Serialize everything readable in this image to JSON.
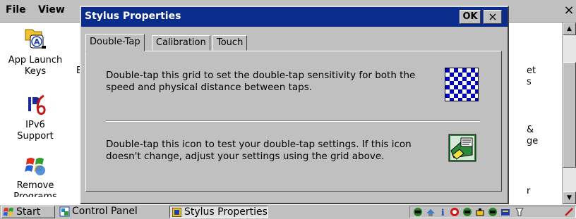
{
  "background_window": {
    "menu": [
      "File",
      "View"
    ],
    "close_glyph": "×",
    "items": [
      {
        "label_line1": "App Launch",
        "label_line2": "Keys",
        "icon": "app-launch-keys-icon"
      },
      {
        "label_line1": "IPv6",
        "label_line2": "Support",
        "icon": "ipv6-icon"
      },
      {
        "label_line1": "Remove",
        "label_line2": "Programs",
        "icon": "remove-programs-icon"
      }
    ],
    "right_fragments": [
      "et",
      "s",
      "&",
      "ge",
      "r"
    ],
    "left_fragment": "E"
  },
  "dialog": {
    "title": "Stylus Properties",
    "ok_label": "OK",
    "close_glyph": "×",
    "tabs": [
      "Double-Tap",
      "Calibration",
      "Touch"
    ],
    "active_tab": "Double-Tap",
    "grid_text": "Double-tap this grid to set the double-tap sensitivity for both the speed and physical distance between taps.",
    "icon_text": "Double-tap this icon to test your double-tap settings. If this icon doesn't change, adjust your settings using the grid above.",
    "grid_colors": {
      "dark": "#0000cc",
      "light": "#ffffff"
    }
  },
  "taskbar": {
    "start_label": "Start",
    "tasks": [
      "Control Panel",
      "Stylus Properties"
    ],
    "active_task": "Stylus Properties",
    "tray_icons": [
      "network-icon",
      "sync-icon",
      "info-icon",
      "radio-icon",
      "network-icon",
      "battery-icon",
      "network-icon",
      "keyboard-icon",
      "input-icon"
    ]
  },
  "colors": {
    "title_bar": "#0a2c8c",
    "face": "#c0c0c0"
  }
}
